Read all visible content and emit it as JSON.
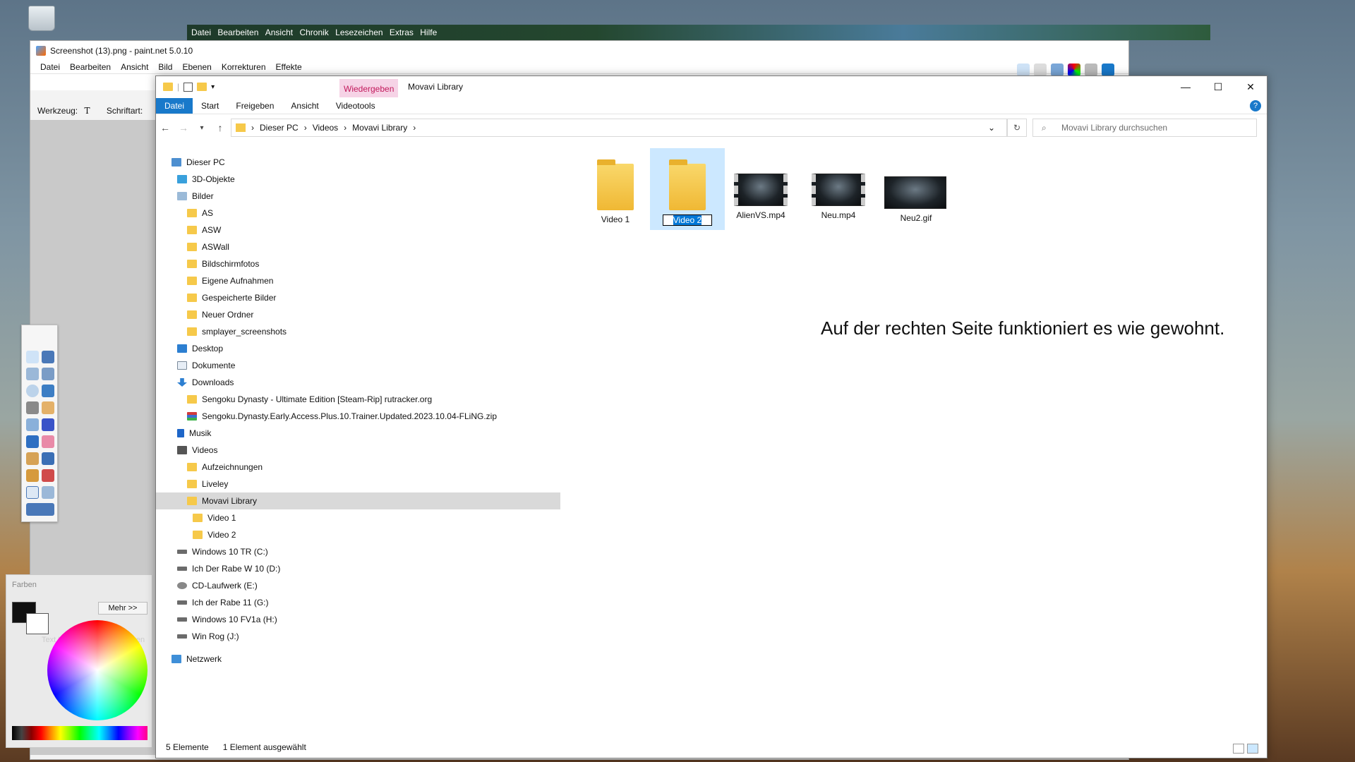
{
  "firefox_menu": [
    "Datei",
    "Bearbeiten",
    "Ansicht",
    "Chronik",
    "Lesezeichen",
    "Extras",
    "Hilfe"
  ],
  "pdn": {
    "title": "Screenshot (13).png - paint.net 5.0.10",
    "menu": [
      "Datei",
      "Bearbeiten",
      "Ansicht",
      "Bild",
      "Ebenen",
      "Korrekturen",
      "Effekte"
    ],
    "tool_label": "Werkzeug:",
    "font_label": "Schriftart:",
    "colors_title": "Farben",
    "more_button": "Mehr >>",
    "hint_text": "Text Klicken Sie mit der linken"
  },
  "explorer": {
    "title": "Movavi Library",
    "context_tab": "Wiedergeben",
    "ribbon": {
      "file": "Datei",
      "start": "Start",
      "share": "Freigeben",
      "view": "Ansicht",
      "videotools": "Videotools"
    },
    "breadcrumb": [
      "Dieser PC",
      "Videos",
      "Movavi Library"
    ],
    "search_placeholder": "Movavi Library durchsuchen",
    "tree": [
      {
        "label": "Dieser PC",
        "icon": "pc-icon"
      },
      {
        "label": "3D-Objekte",
        "icon": "cube-icon"
      },
      {
        "label": "Bilder",
        "icon": "pictures-icon"
      },
      {
        "label": "AS",
        "icon": "folder-icon"
      },
      {
        "label": "ASW",
        "icon": "folder-icon"
      },
      {
        "label": "ASWall",
        "icon": "folder-icon"
      },
      {
        "label": "Bildschirmfotos",
        "icon": "folder-icon"
      },
      {
        "label": "Eigene Aufnahmen",
        "icon": "folder-icon"
      },
      {
        "label": "Gespeicherte Bilder",
        "icon": "folder-icon"
      },
      {
        "label": "Neuer Ordner",
        "icon": "folder-icon"
      },
      {
        "label": "smplayer_screenshots",
        "icon": "folder-icon"
      },
      {
        "label": "Desktop",
        "icon": "desktop-icon"
      },
      {
        "label": "Dokumente",
        "icon": "documents-icon"
      },
      {
        "label": "Downloads",
        "icon": "download-icon"
      },
      {
        "label": "Sengoku Dynasty - Ultimate Edition [Steam-Rip] rutracker.org",
        "icon": "folder-icon"
      },
      {
        "label": "Sengoku.Dynasty.Early.Access.Plus.10.Trainer.Updated.2023.10.04-FLiNG.zip",
        "icon": "zip-icon"
      },
      {
        "label": "Musik",
        "icon": "music-icon"
      },
      {
        "label": "Videos",
        "icon": "videos-icon"
      },
      {
        "label": "Aufzeichnungen",
        "icon": "folder-icon"
      },
      {
        "label": "Liveley",
        "icon": "folder-icon"
      },
      {
        "label": "Movavi Library",
        "icon": "folder-icon"
      },
      {
        "label": "Video 1",
        "icon": "folder-icon"
      },
      {
        "label": "Video 2",
        "icon": "folder-icon"
      },
      {
        "label": "Windows 10 TR (C:)",
        "icon": "drive-icon"
      },
      {
        "label": "Ich Der Rabe W 10 (D:)",
        "icon": "drive-icon"
      },
      {
        "label": "CD-Laufwerk (E:)",
        "icon": "cd-icon"
      },
      {
        "label": "Ich der Rabe 11 (G:)",
        "icon": "drive-icon"
      },
      {
        "label": "Windows 10 FV1a (H:)",
        "icon": "drive-icon"
      },
      {
        "label": "Win Rog (J:)",
        "icon": "drive-icon"
      },
      {
        "label": "Netzwerk",
        "icon": "network-icon"
      }
    ],
    "items": [
      {
        "name": "Video 1",
        "type": "folder"
      },
      {
        "name": "Video 2",
        "type": "folder-rename"
      },
      {
        "name": "AlienVS.mp4",
        "type": "video"
      },
      {
        "name": "Neu.mp4",
        "type": "video"
      },
      {
        "name": "Neu2.gif",
        "type": "gif"
      }
    ],
    "overlay_text": "Auf der rechten Seite funktioniert es wie gewohnt.",
    "status_count": "5 Elemente",
    "status_selected": "1 Element ausgewählt"
  },
  "colors": {
    "accent": "#1979ca",
    "selection": "#cce8ff",
    "folder": "#f6c94a"
  }
}
